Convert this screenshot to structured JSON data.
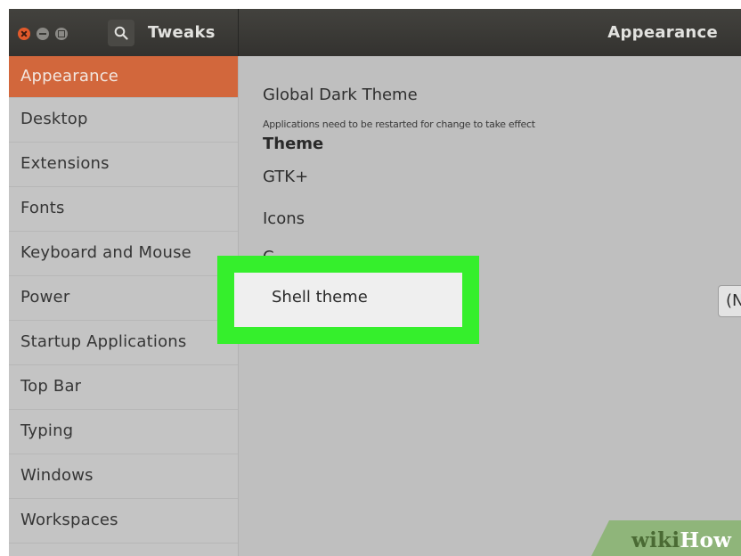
{
  "window": {
    "app_title": "Tweaks",
    "page_title": "Appearance"
  },
  "sidebar": {
    "items": [
      {
        "label": "Appearance",
        "active": true
      },
      {
        "label": "Desktop"
      },
      {
        "label": "Extensions"
      },
      {
        "label": "Fonts"
      },
      {
        "label": "Keyboard and Mouse"
      },
      {
        "label": "Power"
      },
      {
        "label": "Startup Applications"
      },
      {
        "label": "Top Bar"
      },
      {
        "label": "Typing"
      },
      {
        "label": "Windows"
      },
      {
        "label": "Workspaces"
      }
    ]
  },
  "content": {
    "global_dark_theme": "Global Dark Theme",
    "restart_note": "Applications need to be restarted for change to take effect",
    "theme_heading": "Theme",
    "gtk": "GTK+",
    "icons": "Icons",
    "cursor_partial": "C",
    "shell_theme": "Shell theme",
    "shell_theme_value": "(None)"
  },
  "watermark": {
    "wiki": "wiki",
    "how": "How"
  },
  "colors": {
    "accent": "#d2673c",
    "highlight": "#35ef2c",
    "header": "#3a3a36"
  }
}
